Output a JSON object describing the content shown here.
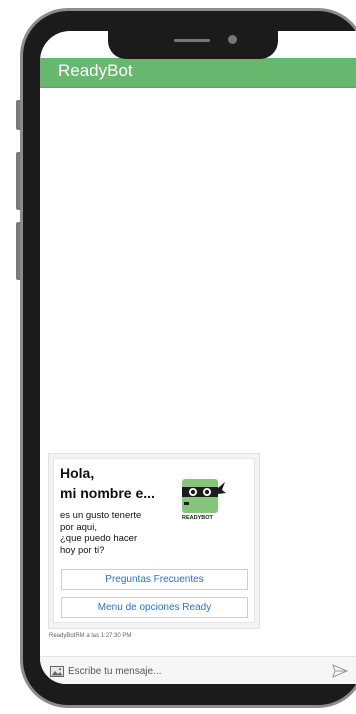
{
  "app": {
    "title": "ReadyBot"
  },
  "message": {
    "greeting_line1": "Hola,",
    "greeting_line2": "mi nombre e...",
    "body_lines": [
      "es un gusto tenerte",
      "por aqui,",
      "¿que puedo hacer",
      "hoy por ti?"
    ],
    "logo_text": "READYBOT",
    "logo_icon": "ninja-robot-icon",
    "buttons": [
      "Preguntas Frecuentes",
      "Menu de opciones Ready"
    ],
    "timestamp": "ReadyBotRM a las 1:27:30 PM"
  },
  "composer": {
    "placeholder": "Escribe tu mensaje...",
    "attach_icon": "image-icon",
    "send_icon": "send-icon"
  },
  "colors": {
    "header": "#67b76e",
    "button_text": "#2e73c6",
    "logo_green": "#86c67b"
  }
}
